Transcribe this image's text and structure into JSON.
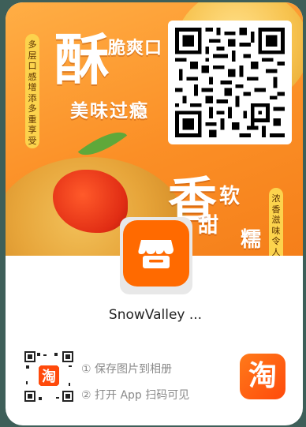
{
  "banner": {
    "left_tag": "多层口感增添多重享受",
    "right_tag": "浓香滋味令人回",
    "headline_big": "酥",
    "headline_small": "脆爽口",
    "headline_sub": "美味过瘾",
    "headline2_big": "香",
    "headline2_a": "软",
    "headline2_b": "甜",
    "headline2_c": "糯"
  },
  "app": {
    "name": "SnowValley ...",
    "logo_icon": "store-icon"
  },
  "steps": {
    "step1": "① 保存图片到相册",
    "step2": "② 打开 App 扫码可见"
  },
  "taobao": {
    "glyph": "淘"
  },
  "colors": {
    "banner": "#fb8f26",
    "tag": "#fcd34d",
    "logo": "#ff6a00",
    "taobao": "#ff4a0b"
  }
}
